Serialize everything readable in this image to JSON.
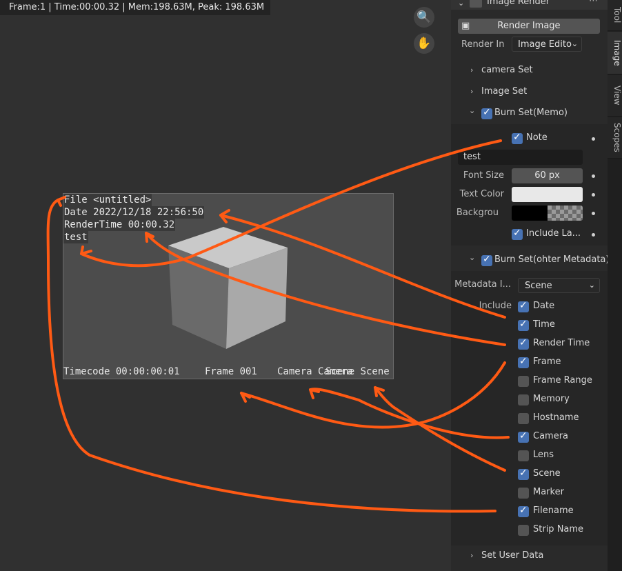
{
  "status_bar": {
    "text": "Frame:1 | Time:00:00.32 | Mem:198.63M, Peak: 198.63M"
  },
  "viewport_buttons": [
    {
      "icon": "zoom-icon"
    },
    {
      "icon": "hand-pan-icon"
    }
  ],
  "render": {
    "top_lines": [
      "File <untitled>",
      "Date 2022/12/18 22:56:50",
      "RenderTime 00:00.32",
      "test"
    ],
    "bottom_items": [
      "Timecode 00:00:00:01",
      "Frame 001",
      "Camera Camera",
      "Scene Scene"
    ]
  },
  "panel": {
    "header": {
      "title": "Image Render",
      "menu_icon": "dots-icon"
    },
    "render_button": "Render Image",
    "render_in": {
      "label": "Render In",
      "value": "Image Edito"
    },
    "sections": {
      "camera_set": "camera Set",
      "image_set": "Image Set",
      "burn_memo": "Burn Set(Memo)",
      "burn_meta": "Burn Set(ohter Metadata)",
      "user_data": "Set User Data"
    },
    "memo": {
      "note_label": "Note",
      "note_text": "test",
      "font_size_label": "Font Size",
      "font_size_value": "60 px",
      "text_color_label": "Text Color",
      "text_color_value": "#e8e8e8",
      "background_label": "Backgrou",
      "include_label": "Include La..."
    },
    "metadata": {
      "input_label": "Metadata I...",
      "input_value": "Scene",
      "include_label": "Include",
      "items": [
        {
          "label": "Date",
          "checked": true
        },
        {
          "label": "Time",
          "checked": true
        },
        {
          "label": "Render Time",
          "checked": true
        },
        {
          "label": "Frame",
          "checked": true
        },
        {
          "label": "Frame Range",
          "checked": false
        },
        {
          "label": "Memory",
          "checked": false
        },
        {
          "label": "Hostname",
          "checked": false
        },
        {
          "label": "Camera",
          "checked": true
        },
        {
          "label": "Lens",
          "checked": false
        },
        {
          "label": "Scene",
          "checked": true
        },
        {
          "label": "Marker",
          "checked": false
        },
        {
          "label": "Filename",
          "checked": true
        },
        {
          "label": "Strip Name",
          "checked": false
        }
      ]
    }
  },
  "side_tabs": [
    "Tool",
    "Image",
    "View",
    "Scopes"
  ],
  "colors": {
    "accent": "#4772b3",
    "annotation": "#ff5a14"
  }
}
